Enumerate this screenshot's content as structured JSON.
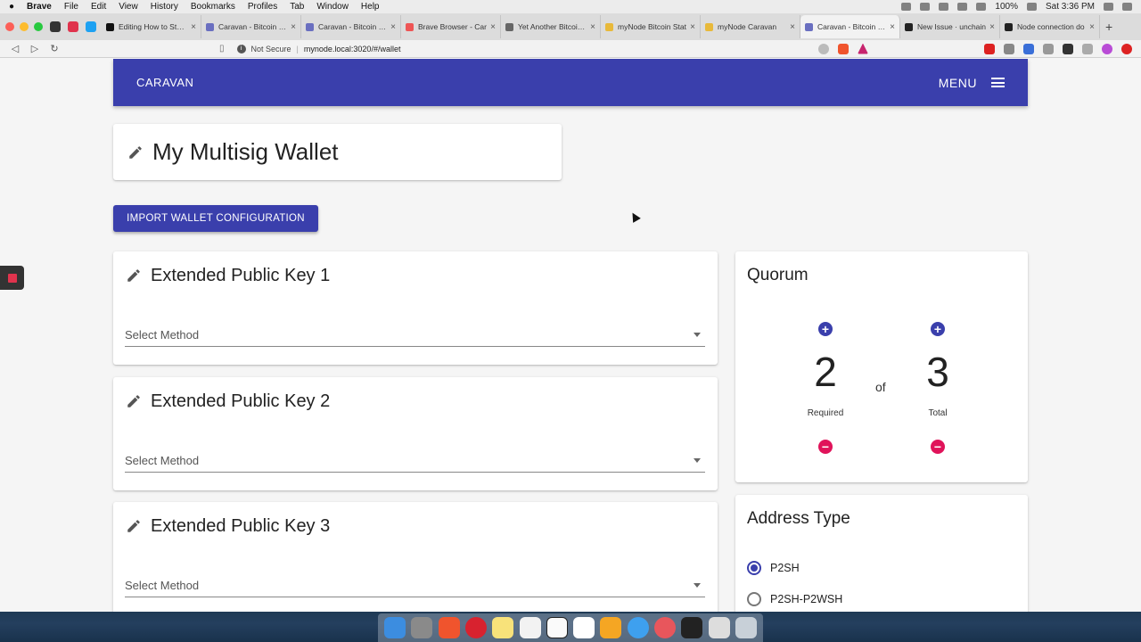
{
  "menubar": {
    "apple": "",
    "app": "Brave",
    "items": [
      "File",
      "Edit",
      "View",
      "History",
      "Bookmarks",
      "Profiles",
      "Tab",
      "Window",
      "Help"
    ],
    "battery": "100%",
    "clock": "Sat 3:36 PM"
  },
  "tabs": [
    {
      "title": "Editing How to Store",
      "active": false
    },
    {
      "title": "Caravan - Bitcoin Mu",
      "active": false
    },
    {
      "title": "Caravan - Bitcoin Mu",
      "active": false
    },
    {
      "title": "Brave Browser - Car",
      "active": false
    },
    {
      "title": "Yet Another Bitcoin T",
      "active": false
    },
    {
      "title": "myNode Bitcoin Stat",
      "active": false
    },
    {
      "title": "myNode Caravan",
      "active": false
    },
    {
      "title": "Caravan - Bitcoin Mu",
      "active": true
    },
    {
      "title": "New Issue · unchain",
      "active": false
    },
    {
      "title": "Node connection do",
      "active": false
    }
  ],
  "tab_close": "×",
  "new_tab": "+",
  "addressbar": {
    "back": "◁",
    "forward": "▷",
    "reload": "↻",
    "security": "Not Secure",
    "separator": "|",
    "url": "mynode.local:3020/#/wallet"
  },
  "appbar": {
    "brand": "CARAVAN",
    "menu": "MENU"
  },
  "wallet": {
    "title": "My Multisig Wallet"
  },
  "import_button": "IMPORT WALLET CONFIGURATION",
  "keys": [
    {
      "title": "Extended Public Key 1",
      "select_placeholder": "Select Method"
    },
    {
      "title": "Extended Public Key 2",
      "select_placeholder": "Select Method"
    },
    {
      "title": "Extended Public Key 3",
      "select_placeholder": "Select Method"
    }
  ],
  "quorum": {
    "title": "Quorum",
    "required": 2,
    "total": 3,
    "of": "of",
    "required_label": "Required",
    "total_label": "Total",
    "plus": "+",
    "minus": "−"
  },
  "address_type": {
    "title": "Address Type",
    "options": [
      "P2SH",
      "P2SH-P2WSH"
    ],
    "selected": "P2SH"
  },
  "colors": {
    "primary": "#3a3fac",
    "danger": "#e0135a"
  }
}
